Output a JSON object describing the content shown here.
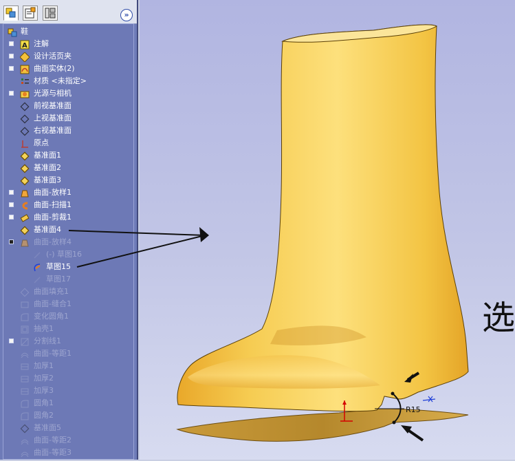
{
  "tree": {
    "root": "鞋",
    "items": [
      {
        "label": "注解",
        "state": "normal",
        "expand": true,
        "icon": "annotation-icon"
      },
      {
        "label": "设计活页夹",
        "state": "normal",
        "expand": true,
        "icon": "design-binder-icon"
      },
      {
        "label": "曲面实体(2)",
        "state": "normal",
        "expand": true,
        "icon": "surface-bodies-icon"
      },
      {
        "label": "材质 <未指定>",
        "state": "normal",
        "expand": false,
        "icon": "material-icon"
      },
      {
        "label": "光源与相机",
        "state": "normal",
        "expand": true,
        "icon": "lights-cameras-icon"
      },
      {
        "label": "前视基准面",
        "state": "normal",
        "expand": false,
        "icon": "plane-icon"
      },
      {
        "label": "上视基准面",
        "state": "normal",
        "expand": false,
        "icon": "plane-icon"
      },
      {
        "label": "右视基准面",
        "state": "normal",
        "expand": false,
        "icon": "plane-icon"
      },
      {
        "label": "原点",
        "state": "normal",
        "expand": false,
        "icon": "origin-icon"
      },
      {
        "label": "基准面1",
        "state": "normal",
        "expand": false,
        "icon": "plane-yellow-icon"
      },
      {
        "label": "基准面2",
        "state": "normal",
        "expand": false,
        "icon": "plane-yellow-icon"
      },
      {
        "label": "基准面3",
        "state": "normal",
        "expand": false,
        "icon": "plane-yellow-icon"
      },
      {
        "label": "曲面-放样1",
        "state": "normal",
        "expand": true,
        "icon": "surface-loft-icon"
      },
      {
        "label": "曲面-扫描1",
        "state": "normal",
        "expand": true,
        "icon": "surface-sweep-icon"
      },
      {
        "label": "曲面-剪裁1",
        "state": "normal",
        "expand": true,
        "icon": "surface-trim-icon"
      },
      {
        "label": "基准面4",
        "state": "normal",
        "expand": false,
        "icon": "plane-yellow-icon"
      },
      {
        "label": "曲面-放样4",
        "state": "dim",
        "expand": "open",
        "icon": "surface-loft-icon"
      },
      {
        "label": "(-) 草图16",
        "state": "dim",
        "expand": false,
        "icon": "sketch-icon",
        "indent": 1
      },
      {
        "label": "草图15",
        "state": "normal",
        "expand": false,
        "icon": "sketch-active-icon",
        "indent": 1
      },
      {
        "label": "草图17",
        "state": "dim",
        "expand": false,
        "icon": "sketch-icon",
        "indent": 1
      },
      {
        "label": "曲面填充1",
        "state": "dim",
        "expand": false,
        "icon": "surface-fill-icon"
      },
      {
        "label": "曲面-缝合1",
        "state": "dim",
        "expand": false,
        "icon": "surface-knit-icon"
      },
      {
        "label": "变化圆角1",
        "state": "dim",
        "expand": false,
        "icon": "fillet-icon"
      },
      {
        "label": "抽壳1",
        "state": "dim",
        "expand": false,
        "icon": "shell-icon"
      },
      {
        "label": "分割线1",
        "state": "dim",
        "expand": true,
        "icon": "split-line-icon"
      },
      {
        "label": "曲面-等距1",
        "state": "dim",
        "expand": false,
        "icon": "surface-offset-icon"
      },
      {
        "label": "加厚1",
        "state": "dim",
        "expand": false,
        "icon": "thicken-icon"
      },
      {
        "label": "加厚2",
        "state": "dim",
        "expand": false,
        "icon": "thicken-icon"
      },
      {
        "label": "加厚3",
        "state": "dim",
        "expand": false,
        "icon": "thicken-icon"
      },
      {
        "label": "圆角1",
        "state": "dim",
        "expand": false,
        "icon": "fillet-icon"
      },
      {
        "label": "圆角2",
        "state": "dim",
        "expand": false,
        "icon": "fillet-icon"
      },
      {
        "label": "基准面5",
        "state": "dim",
        "expand": false,
        "icon": "plane-icon"
      },
      {
        "label": "曲面-等距2",
        "state": "dim",
        "expand": false,
        "icon": "surface-offset-icon"
      },
      {
        "label": "曲面-等距3",
        "state": "dim",
        "expand": false,
        "icon": "surface-offset-icon"
      }
    ]
  },
  "tabs": [
    {
      "name": "feature-manager-tab",
      "icon": "feature-tree-icon"
    },
    {
      "name": "property-manager-tab",
      "icon": "property-icon"
    },
    {
      "name": "configuration-manager-tab",
      "icon": "config-icon"
    }
  ],
  "viewport": {
    "dimension_label": "R15",
    "handwritten_note": "选"
  },
  "colors": {
    "sidebar_bg": "#6d79b6",
    "boot_yellow": "#f3c442",
    "sole_brown": "#b88a2c",
    "dimension_black": "#111111"
  }
}
